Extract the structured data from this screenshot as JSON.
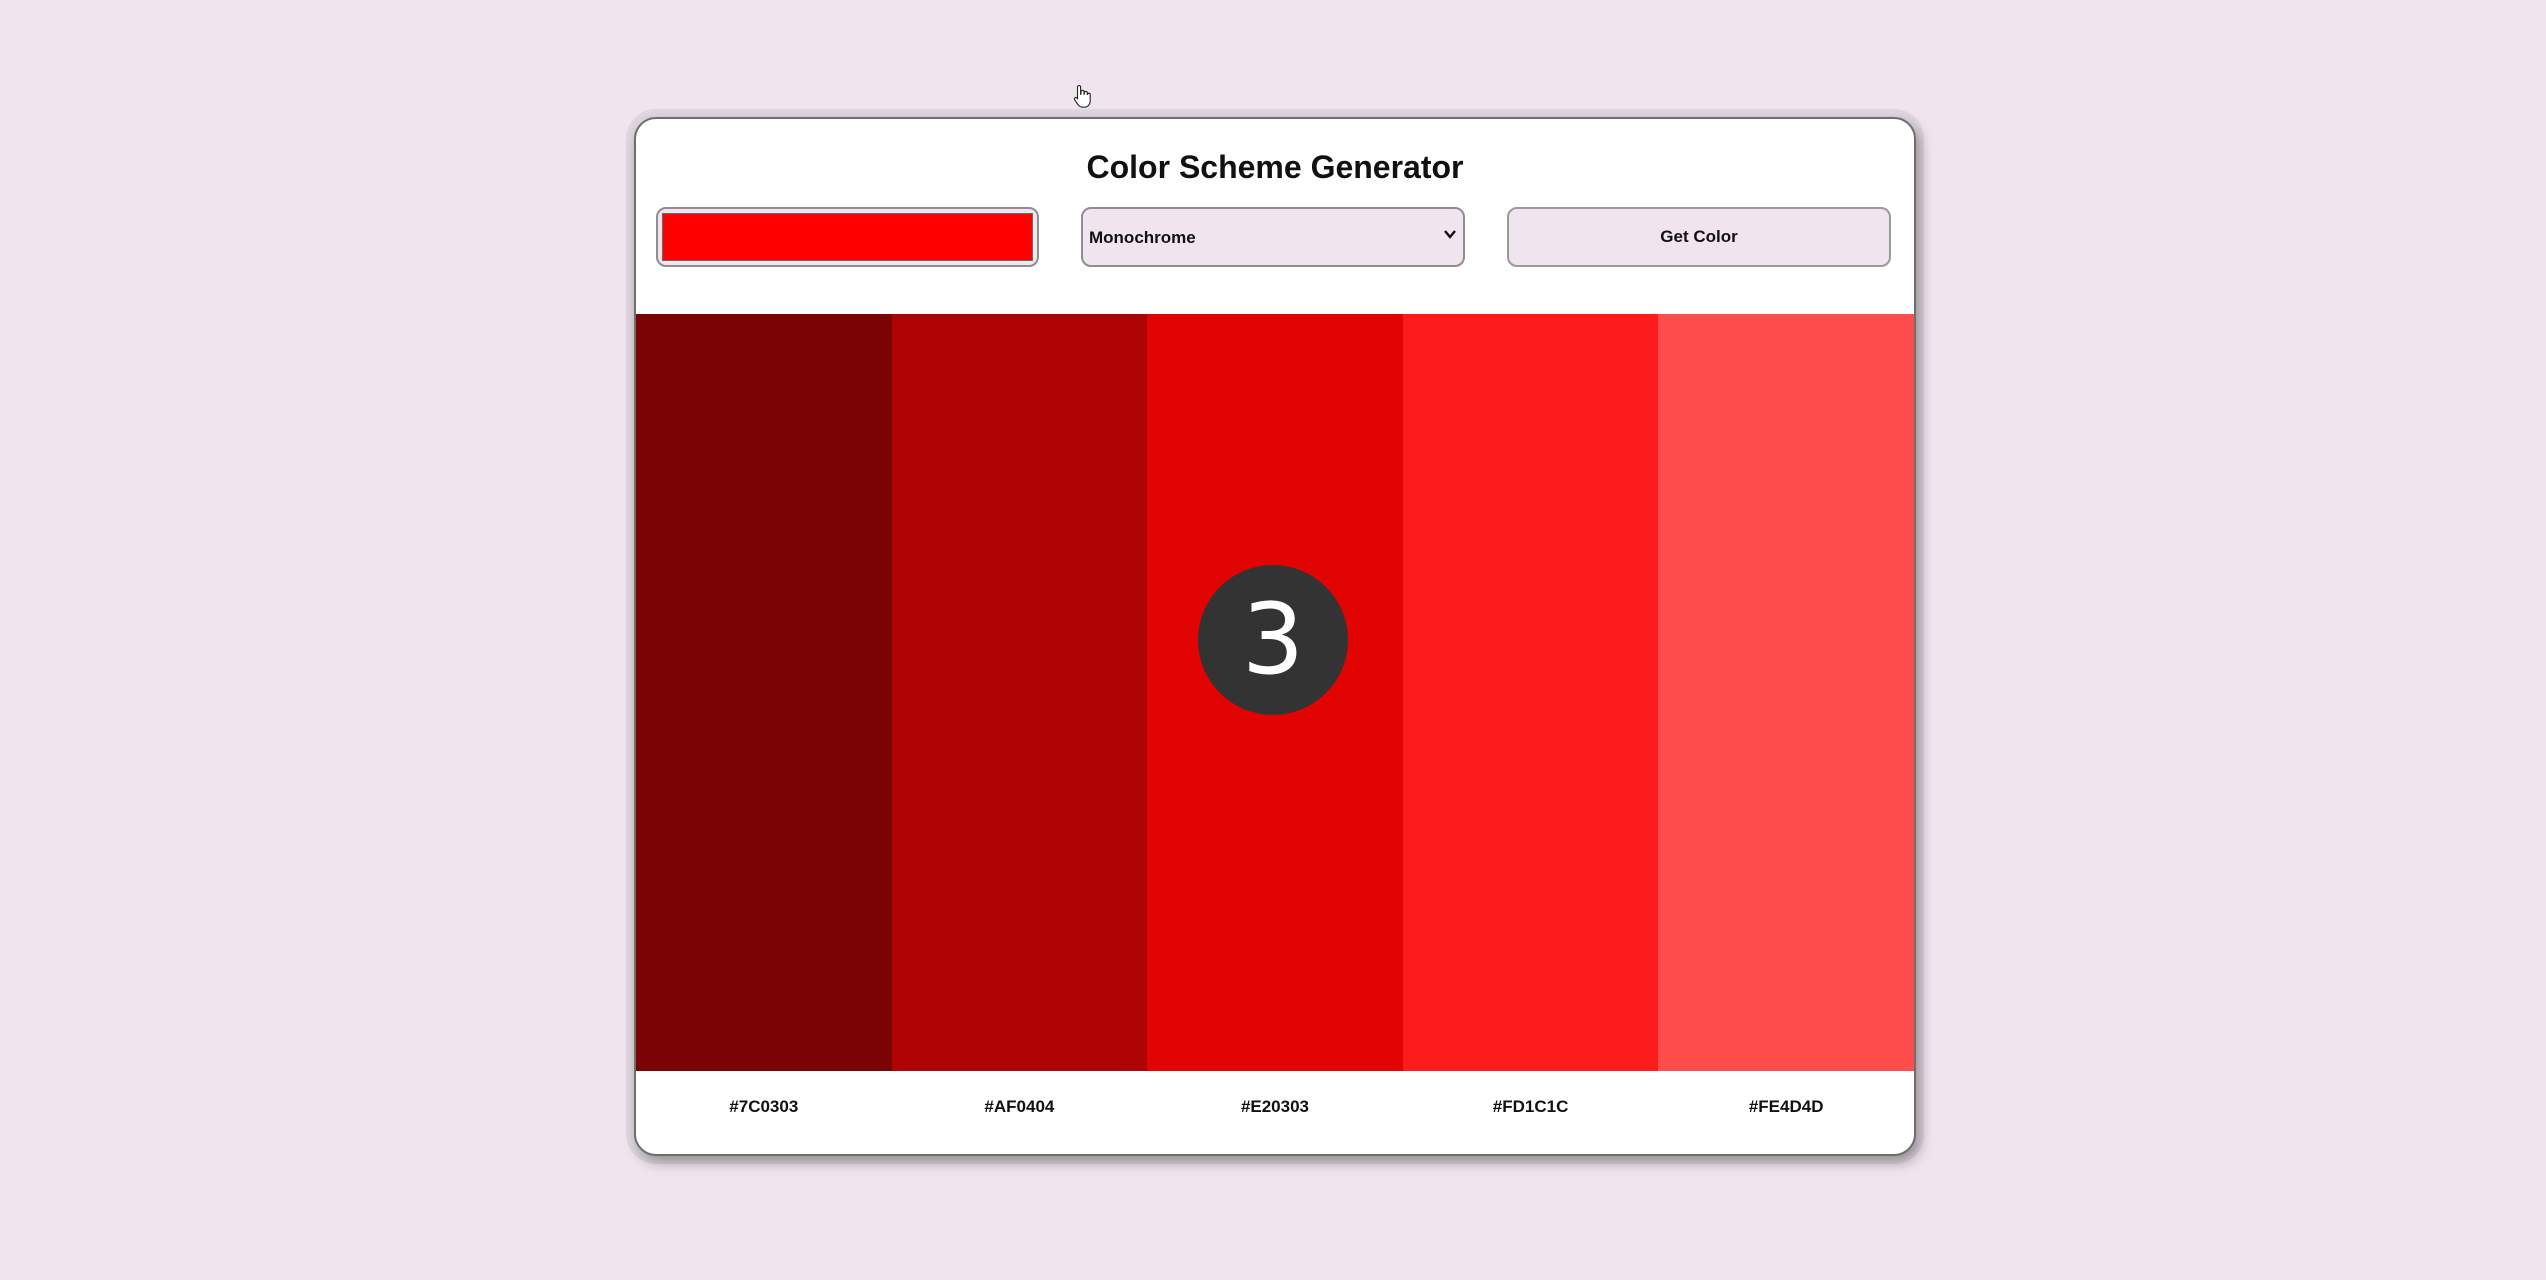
{
  "app": {
    "title": "Color Scheme Generator"
  },
  "controls": {
    "color_input_value": "#FF0000",
    "scheme_mode": "Monochrome",
    "get_color_label": "Get Color"
  },
  "palette": [
    {
      "hex": "#7C0303"
    },
    {
      "hex": "#AF0404"
    },
    {
      "hex": "#E20303"
    },
    {
      "hex": "#FD1C1C"
    },
    {
      "hex": "#FE4D4D"
    }
  ],
  "overlay": {
    "step_number": "3"
  },
  "icons": {
    "select_arrow": "chevron-down-icon",
    "cursor": "hand-pointer-icon"
  }
}
